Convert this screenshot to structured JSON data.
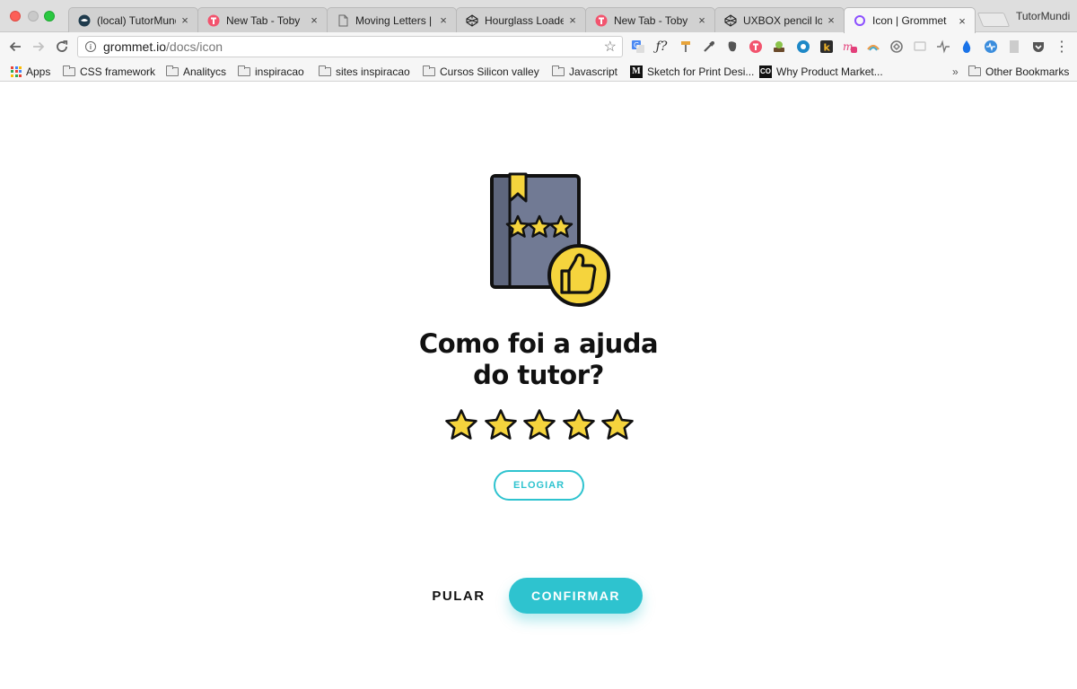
{
  "browser": {
    "tabs": [
      {
        "title": "(local) TutorMundi",
        "icon": "tutormundi-icon",
        "active": false
      },
      {
        "title": "New Tab - Toby",
        "icon": "toby-icon",
        "active": false
      },
      {
        "title": "Moving Letters | T",
        "icon": "page-icon",
        "active": false
      },
      {
        "title": "Hourglass Loader",
        "icon": "codepen-icon",
        "active": false
      },
      {
        "title": "New Tab - Toby",
        "icon": "toby-icon",
        "active": false
      },
      {
        "title": "UXBOX pencil loa",
        "icon": "codepen-icon",
        "active": false
      },
      {
        "title": "Icon | Grommet",
        "icon": "grommet-icon",
        "active": true
      }
    ],
    "tab_close": "×",
    "profile_name": "TutorMundi",
    "url_host": "grommet.io",
    "url_path": "/docs/icon",
    "bookmarks": {
      "apps_label": "Apps",
      "items": [
        {
          "label": "CSS framework",
          "icon": "folder-icon"
        },
        {
          "label": "Analitycs",
          "icon": "folder-icon"
        },
        {
          "label": "inspiracao",
          "icon": "folder-icon"
        },
        {
          "label": "sites inspiracao",
          "icon": "folder-icon"
        },
        {
          "label": "Cursos Silicon valley",
          "icon": "folder-icon"
        },
        {
          "label": "Javascript",
          "icon": "folder-icon"
        },
        {
          "label": "Sketch for Print Desi...",
          "icon": "medium-icon"
        },
        {
          "label": "Why Product Market...",
          "icon": "co-icon"
        }
      ],
      "overflow": "»",
      "other_label": "Other Bookmarks"
    }
  },
  "feedback": {
    "title_line1": "Como foi a ajuda",
    "title_line2": "do tutor?",
    "rating": 5,
    "rating_max": 5,
    "praise_label": "ELOGIAR",
    "skip_label": "PULAR",
    "confirm_label": "CONFIRMAR"
  },
  "colors": {
    "accent": "#2ec3cf",
    "star_fill": "#f5d43d",
    "book": "#717a94",
    "badge": "#f5d43d"
  }
}
